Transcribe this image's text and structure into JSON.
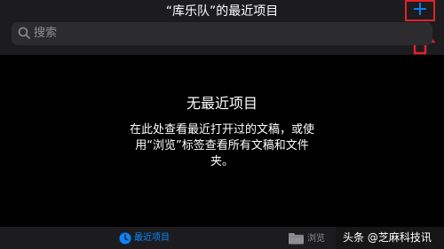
{
  "header": {
    "title": "“库乐队”的最近项目",
    "add_icon": "plus-icon",
    "accent": "#0a84ff",
    "highlight_color": "#e0212b"
  },
  "search": {
    "placeholder": "搜索",
    "icon": "search-icon"
  },
  "empty_state": {
    "title": "无最近项目",
    "description": "在此处查看最近打开过的文稿，或使用“浏览”标签查看所有文稿和文件夹。"
  },
  "tabbar": {
    "recent_label": "最近项目",
    "recent_icon": "clock-icon",
    "browse_label": "浏览",
    "browse_icon": "folder-icon"
  },
  "watermark": {
    "text": "头条 @芝麻科技讯"
  }
}
